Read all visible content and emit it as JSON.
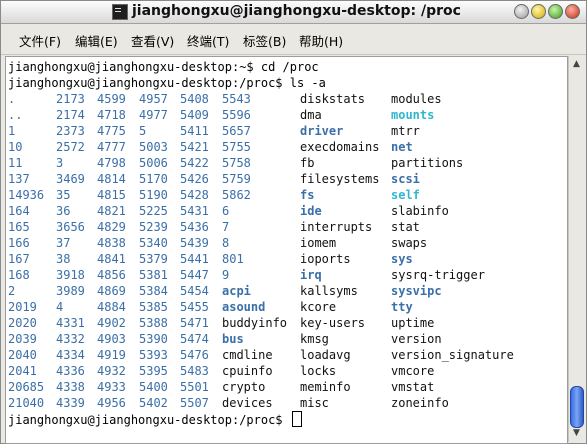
{
  "window": {
    "title": "jianghongxu@jianghongxu-desktop: /proc"
  },
  "menu": [
    "文件(F)",
    "编辑(E)",
    "查看(V)",
    "终端(T)",
    "标签(B)",
    "帮助(H)"
  ],
  "terminal": {
    "line1": "jianghongxu@jianghongxu-desktop:~$ cd /proc",
    "line2": "jianghongxu@jianghongxu-desktop:/proc$ ls -a",
    "prompt": "jianghongxu@jianghongxu-desktop:/proc$ ",
    "rows": [
      [
        ".",
        "2173",
        "4599",
        "4957",
        "5408",
        "5543",
        "diskstats",
        "modules"
      ],
      [
        "..",
        "2174",
        "4718",
        "4977",
        "5409",
        "5596",
        "dma",
        "mounts"
      ],
      [
        "1",
        "2373",
        "4775",
        "5",
        "5411",
        "5657",
        "driver",
        "mtrr"
      ],
      [
        "10",
        "2572",
        "4777",
        "5003",
        "5421",
        "5755",
        "execdomains",
        "net"
      ],
      [
        "11",
        "3",
        "4798",
        "5006",
        "5422",
        "5758",
        "fb",
        "partitions"
      ],
      [
        "137",
        "3469",
        "4814",
        "5170",
        "5426",
        "5759",
        "filesystems",
        "scsi"
      ],
      [
        "14936",
        "35",
        "4815",
        "5190",
        "5428",
        "5862",
        "fs",
        "self"
      ],
      [
        "164",
        "36",
        "4821",
        "5225",
        "5431",
        "6",
        "ide",
        "slabinfo"
      ],
      [
        "165",
        "3656",
        "4829",
        "5239",
        "5436",
        "7",
        "interrupts",
        "stat"
      ],
      [
        "166",
        "37",
        "4838",
        "5340",
        "5439",
        "8",
        "iomem",
        "swaps"
      ],
      [
        "167",
        "38",
        "4841",
        "5379",
        "5441",
        "801",
        "ioports",
        "sys"
      ],
      [
        "168",
        "3918",
        "4856",
        "5381",
        "5447",
        "9",
        "irq",
        "sysrq-trigger"
      ],
      [
        "2",
        "3989",
        "4869",
        "5384",
        "5454",
        "acpi",
        "kallsyms",
        "sysvipc"
      ],
      [
        "2019",
        "4",
        "4884",
        "5385",
        "5455",
        "asound",
        "kcore",
        "tty"
      ],
      [
        "2020",
        "4331",
        "4902",
        "5388",
        "5471",
        "buddyinfo",
        "key-users",
        "uptime"
      ],
      [
        "2039",
        "4332",
        "4903",
        "5390",
        "5474",
        "bus",
        "kmsg",
        "version"
      ],
      [
        "2040",
        "4334",
        "4919",
        "5393",
        "5476",
        "cmdline",
        "loadavg",
        "version_signature"
      ],
      [
        "2041",
        "4336",
        "4932",
        "5395",
        "5483",
        "cpuinfo",
        "locks",
        "vmcore"
      ],
      [
        "20685",
        "4338",
        "4933",
        "5400",
        "5501",
        "crypto",
        "meminfo",
        "vmstat"
      ],
      [
        "21040",
        "4339",
        "4956",
        "5402",
        "5507",
        "devices",
        "misc",
        "zoneinfo"
      ]
    ],
    "styles": [
      [
        "blue",
        "blue",
        "blue",
        "blue",
        "blue",
        "blue",
        "plain",
        "plain"
      ],
      [
        "blue",
        "blue",
        "blue",
        "blue",
        "blue",
        "blue",
        "plain",
        "cyan"
      ],
      [
        "blue",
        "blue",
        "blue",
        "blue",
        "blue",
        "blue",
        "bold",
        "plain"
      ],
      [
        "blue",
        "blue",
        "blue",
        "blue",
        "blue",
        "blue",
        "plain",
        "bold"
      ],
      [
        "blue",
        "blue",
        "blue",
        "blue",
        "blue",
        "blue",
        "plain",
        "plain"
      ],
      [
        "blue",
        "blue",
        "blue",
        "blue",
        "blue",
        "blue",
        "plain",
        "bold"
      ],
      [
        "blue",
        "blue",
        "blue",
        "blue",
        "blue",
        "blue",
        "bold",
        "cyan"
      ],
      [
        "blue",
        "blue",
        "blue",
        "blue",
        "blue",
        "blue",
        "bold",
        "plain"
      ],
      [
        "blue",
        "blue",
        "blue",
        "blue",
        "blue",
        "blue",
        "plain",
        "plain"
      ],
      [
        "blue",
        "blue",
        "blue",
        "blue",
        "blue",
        "blue",
        "plain",
        "plain"
      ],
      [
        "blue",
        "blue",
        "blue",
        "blue",
        "blue",
        "blue",
        "plain",
        "bold"
      ],
      [
        "blue",
        "blue",
        "blue",
        "blue",
        "blue",
        "blue",
        "bold",
        "plain"
      ],
      [
        "blue",
        "blue",
        "blue",
        "blue",
        "blue",
        "bold",
        "plain",
        "bold"
      ],
      [
        "blue",
        "blue",
        "blue",
        "blue",
        "blue",
        "bold",
        "plain",
        "bold"
      ],
      [
        "blue",
        "blue",
        "blue",
        "blue",
        "blue",
        "plain",
        "plain",
        "plain"
      ],
      [
        "blue",
        "blue",
        "blue",
        "blue",
        "blue",
        "bold",
        "plain",
        "plain"
      ],
      [
        "blue",
        "blue",
        "blue",
        "blue",
        "blue",
        "plain",
        "plain",
        "plain"
      ],
      [
        "blue",
        "blue",
        "blue",
        "blue",
        "blue",
        "plain",
        "plain",
        "plain"
      ],
      [
        "blue",
        "blue",
        "blue",
        "blue",
        "blue",
        "plain",
        "plain",
        "plain"
      ],
      [
        "blue",
        "blue",
        "blue",
        "blue",
        "blue",
        "plain",
        "plain",
        "plain"
      ]
    ]
  },
  "colors": {
    "dir": "#3b6fa8",
    "link": "#2fb7cf",
    "plain": "#111111"
  },
  "icons": {
    "app": "terminal-icon",
    "buttons": [
      "window-menu-icon",
      "minimize-icon",
      "maximize-icon",
      "close-icon"
    ]
  }
}
